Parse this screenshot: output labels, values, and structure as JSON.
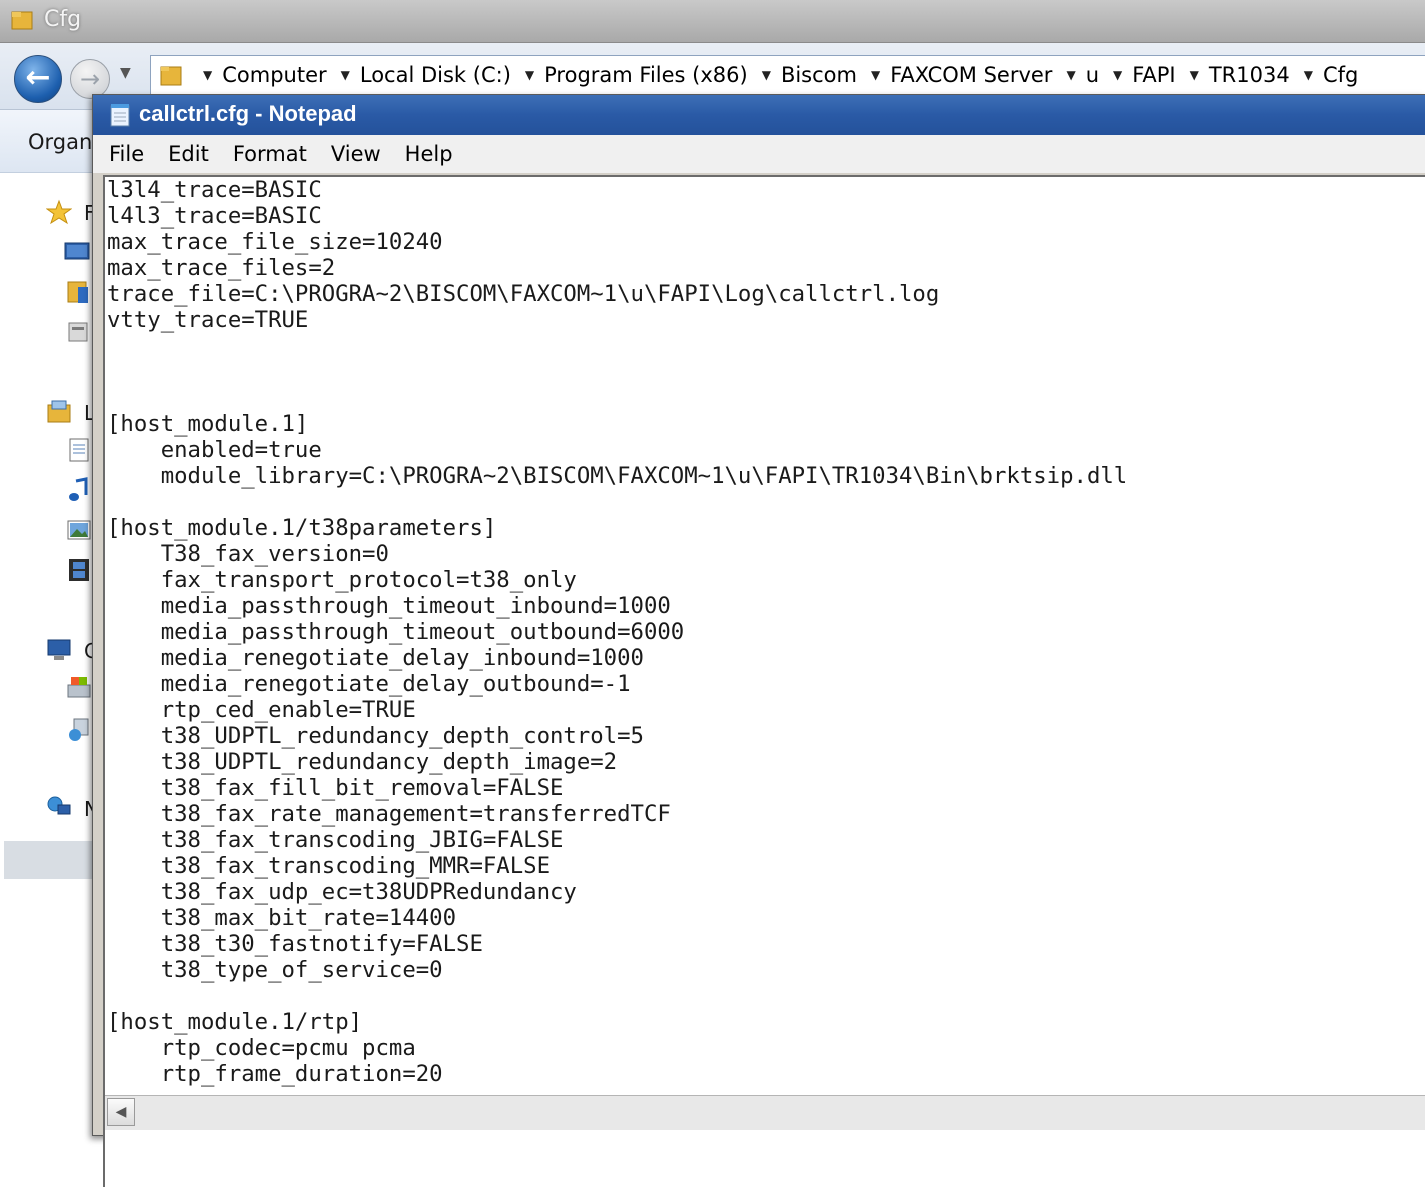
{
  "explorer": {
    "window_title": "Cfg",
    "organize_label": "Organi",
    "breadcrumbs": [
      "Computer",
      "Local Disk (C:)",
      "Program Files (x86)",
      "Biscom",
      "FAXCOM Server",
      "u",
      "FAPI",
      "TR1034",
      "Cfg"
    ],
    "sidebar_letters": [
      "F",
      "L",
      "C",
      "N"
    ]
  },
  "notepad": {
    "window_title": "callctrl.cfg - Notepad",
    "menu": [
      "File",
      "Edit",
      "Format",
      "View",
      "Help"
    ],
    "lines": [
      "l3l4_trace=BASIC",
      "l4l3_trace=BASIC",
      "max_trace_file_size=10240",
      "max_trace_files=2",
      "trace_file=C:\\PROGRA~2\\BISCOM\\FAXCOM~1\\u\\FAPI\\Log\\callctrl.log",
      "vtty_trace=TRUE",
      "",
      "",
      "",
      "[host_module.1]",
      "    enabled=true",
      "    module_library=C:\\PROGRA~2\\BISCOM\\FAXCOM~1\\u\\FAPI\\TR1034\\Bin\\brktsip.dll",
      "",
      "[host_module.1/t38parameters]",
      "    T38_fax_version=0",
      "    fax_transport_protocol=t38_only",
      "    media_passthrough_timeout_inbound=1000",
      "    media_passthrough_timeout_outbound=6000",
      "    media_renegotiate_delay_inbound=1000",
      "    media_renegotiate_delay_outbound=-1",
      "    rtp_ced_enable=TRUE",
      "    t38_UDPTL_redundancy_depth_control=5",
      "    t38_UDPTL_redundancy_depth_image=2",
      "    t38_fax_fill_bit_removal=FALSE",
      "    t38_fax_rate_management=transferredTCF",
      "    t38_fax_transcoding_JBIG=FALSE",
      "    t38_fax_transcoding_MMR=FALSE",
      "    t38_fax_udp_ec=t38UDPRedundancy",
      "    t38_max_bit_rate=14400",
      "    t38_t30_fastnotify=FALSE",
      "    t38_type_of_service=0",
      "",
      "[host_module.1/rtp]",
      "    rtp_codec=pcmu pcma",
      "    rtp_frame_duration=20"
    ]
  }
}
